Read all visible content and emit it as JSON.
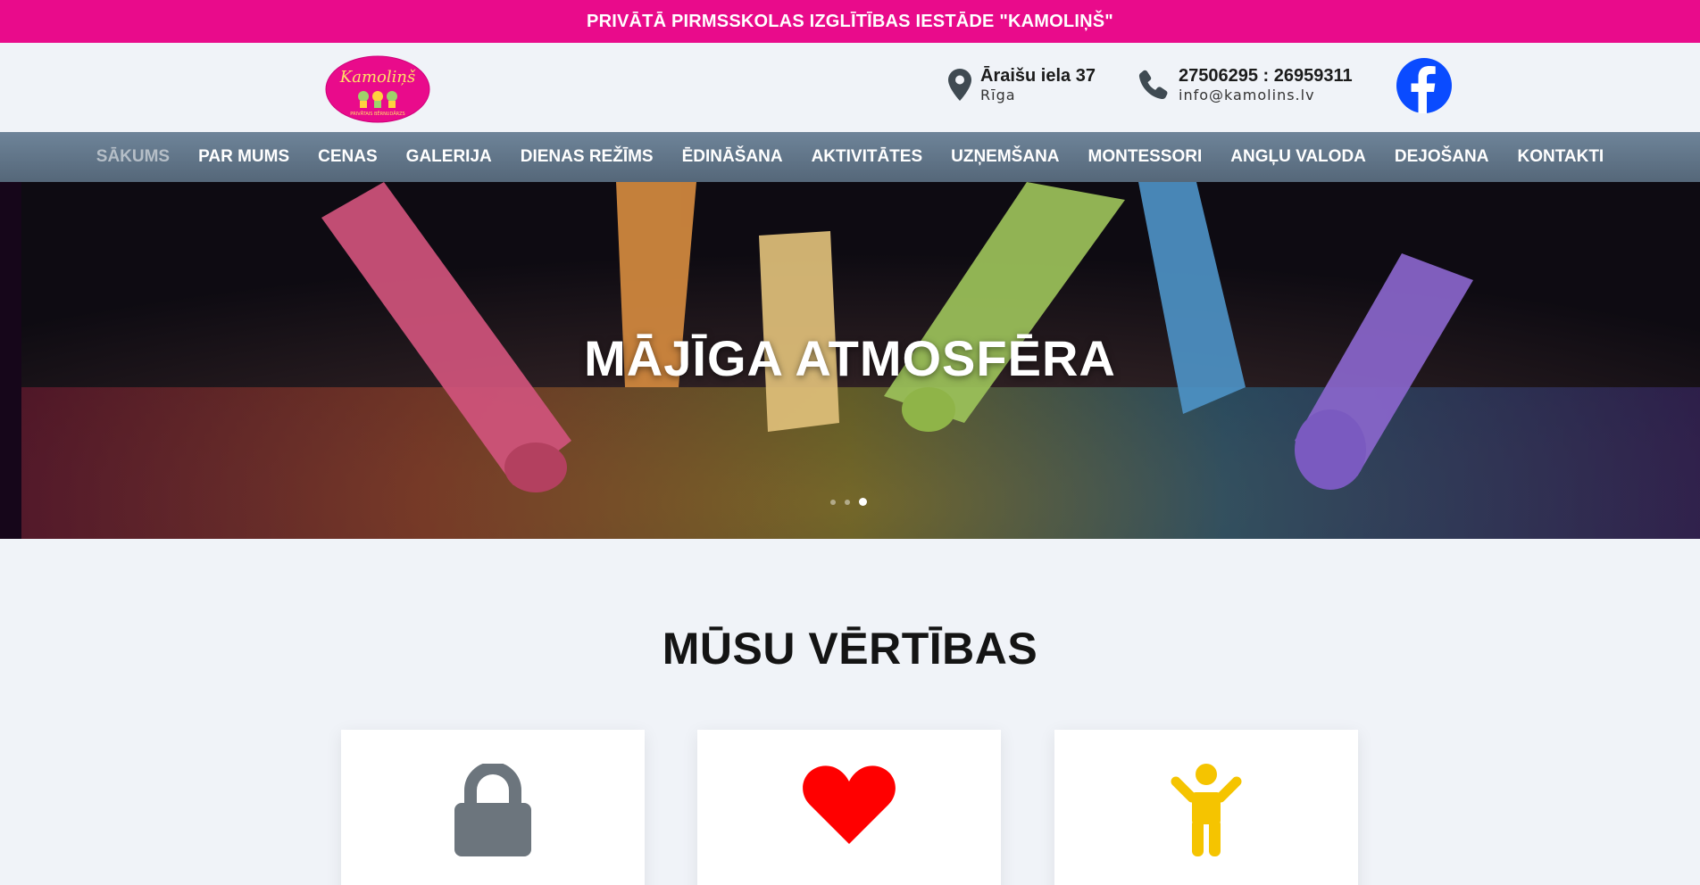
{
  "topbar": {
    "title": "PRIVĀTĀ PIRMSSKOLAS IZGLĪTĪBAS IESTĀDE \"KAMOLIŅŠ\""
  },
  "header": {
    "logo": {
      "text": "Kamoliņš",
      "subtext": "PRIVĀTAIS BĒRNUDĀRZS",
      "color": "#e90b8b"
    },
    "address": {
      "line1": "Āraišu iela 37",
      "line2": "Rīga",
      "icon": "map-pin-icon"
    },
    "contact": {
      "line1": "27506295 : 26959311",
      "line2": "info@kamolins.lv",
      "icon": "phone-icon"
    },
    "social": {
      "icon": "facebook-icon",
      "color": "#1877f2"
    }
  },
  "nav": {
    "items": [
      {
        "label": "SĀKUMS",
        "active": true
      },
      {
        "label": "PAR MUMS"
      },
      {
        "label": "CENAS"
      },
      {
        "label": "GALERIJA"
      },
      {
        "label": "DIENAS REŽĪMS"
      },
      {
        "label": "ĒDINĀŠANA"
      },
      {
        "label": "AKTIVITĀTES"
      },
      {
        "label": "UZŅEMŠANA"
      },
      {
        "label": "MONTESSORI"
      },
      {
        "label": "ANGĻU VALODA"
      },
      {
        "label": "DEJOŠANA"
      },
      {
        "label": "KONTAKTI"
      }
    ]
  },
  "hero": {
    "title": "MĀJĪGA ATMOSFĒRA",
    "slide_count": 3,
    "active_slide": 3
  },
  "values": {
    "title": "MŪSU VĒRTĪBAS",
    "cards": [
      {
        "icon": "lock-icon",
        "color": "#6c757d"
      },
      {
        "icon": "heart-icon",
        "color": "#ff0000"
      },
      {
        "icon": "child-icon",
        "color": "#f5c400"
      }
    ]
  }
}
